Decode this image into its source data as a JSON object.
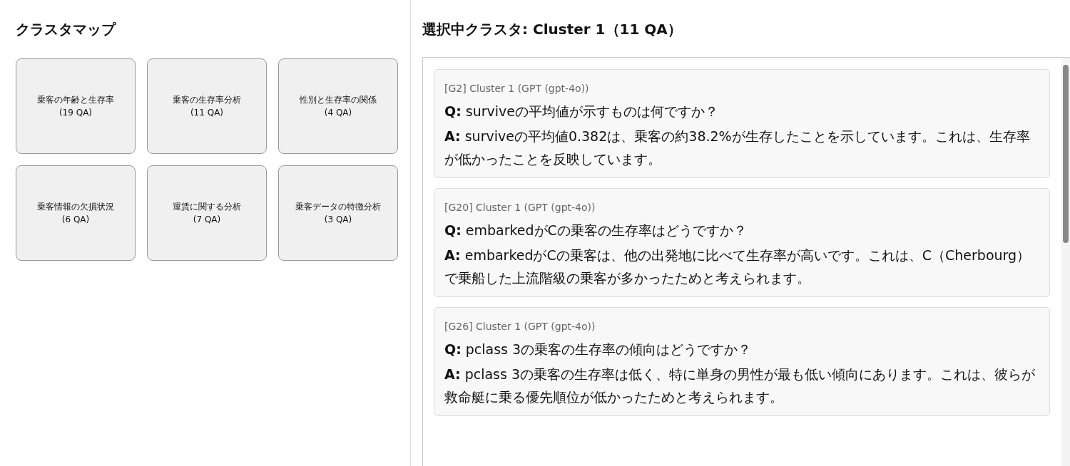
{
  "cluster_map": {
    "title": "クラスタマップ",
    "tiles": [
      {
        "label": "乗客の年齢と生存率",
        "count": "(19 QA)"
      },
      {
        "label": "乗客の生存率分析",
        "count": "(11 QA)"
      },
      {
        "label": "性別と生存率の関係",
        "count": "(4 QA)"
      },
      {
        "label": "乗客情報の欠損状況",
        "count": "(6 QA)"
      },
      {
        "label": "運賃に関する分析",
        "count": "(7 QA)"
      },
      {
        "label": "乗客データの特徴分析",
        "count": "(3 QA)"
      }
    ]
  },
  "selected_cluster": {
    "title": "選択中クラスタ: Cluster 1（11 QA）",
    "qa_items": [
      {
        "source": "[G2] Cluster 1 (GPT (gpt-4o))",
        "question": "**Q:** surviveの平均値が示すものは何ですか？",
        "answer": "**A:** surviveの平均値0.382は、乗客の約38.2%が生存したことを示しています。これは、生存率が低かったことを反映しています。"
      },
      {
        "source": "[G20] Cluster 1 (GPT (gpt-4o))",
        "question": "**Q:** embarkedがCの乗客の生存率はどうですか？",
        "answer": "**A:** embarkedがCの乗客は、他の出発地に比べて生存率が高いです。これは、C（Cherbourg）で乗船した上流階級の乗客が多かったためと考えられます。"
      },
      {
        "source": "[G26] Cluster 1 (GPT (gpt-4o))",
        "question": "**Q:** pclass 3の乗客の生存率の傾向はどうですか？",
        "answer": "**A:** pclass 3の乗客の生存率は低く、特に単身の男性が最も低い傾向にあります。これは、彼らが救命艇に乗る優先順位が低かったためと考えられます。"
      }
    ]
  }
}
